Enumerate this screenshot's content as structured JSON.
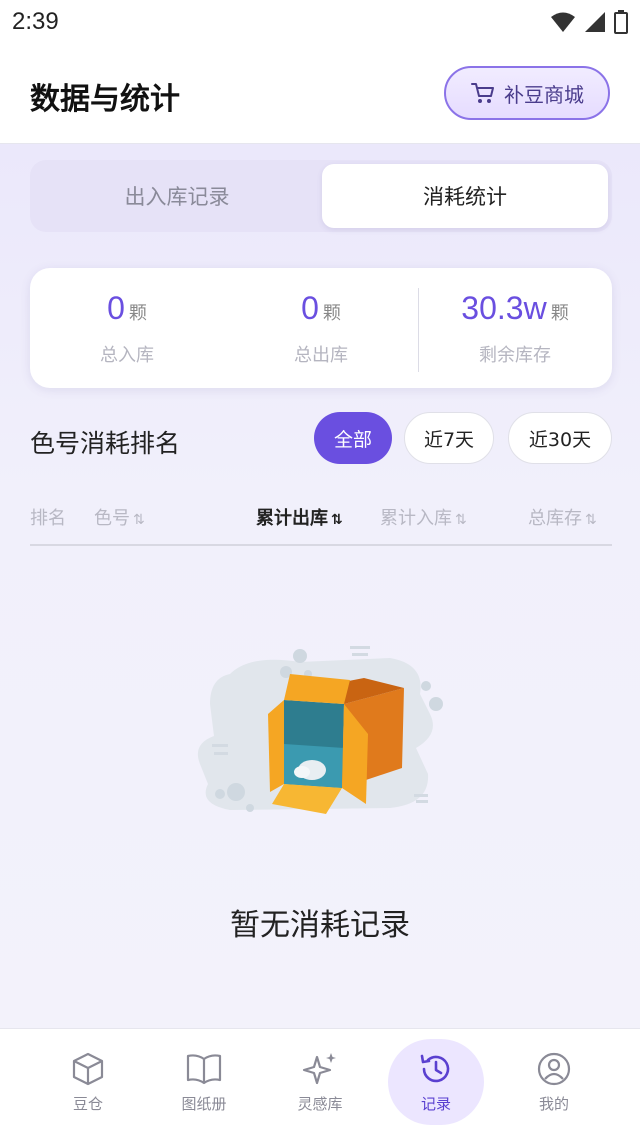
{
  "status_bar": {
    "time": "2:39"
  },
  "header": {
    "title": "数据与统计",
    "shop_button_label": "补豆商城"
  },
  "segments": {
    "inout_label": "出入库记录",
    "consume_label": "消耗统计",
    "selected": "消耗统计"
  },
  "stats": {
    "total_in": {
      "value": "0",
      "unit": "颗",
      "label": "总入库"
    },
    "total_out": {
      "value": "0",
      "unit": "颗",
      "label": "总出库"
    },
    "remaining": {
      "value": "30.3w",
      "unit": "颗",
      "label": "剩余库存"
    }
  },
  "ranking": {
    "title": "色号消耗排名",
    "filters": {
      "all": "全部",
      "d7": "近7天",
      "d30": "近30天"
    },
    "selected_filter": "全部",
    "columns": {
      "rank": "排名",
      "color": "色号",
      "total_out": "累计出库",
      "total_in": "累计入库",
      "stock": "总库存"
    },
    "sort_glyph": "⇅",
    "empty_text": "暂无消耗记录"
  },
  "tabbar": {
    "items": [
      {
        "label": "豆仓",
        "icon": "box-icon"
      },
      {
        "label": "图纸册",
        "icon": "book-icon"
      },
      {
        "label": "灵感库",
        "icon": "sparkle-icon"
      },
      {
        "label": "记录",
        "icon": "history-icon"
      },
      {
        "label": "我的",
        "icon": "user-icon"
      }
    ],
    "active": "记录"
  },
  "colors": {
    "accent": "#6a4fe0",
    "active_tab_bg": "#ece6ff",
    "box_orange": "#f5a623",
    "box_dark_orange": "#e07a1c",
    "box_teal": "#2e7d8f"
  }
}
